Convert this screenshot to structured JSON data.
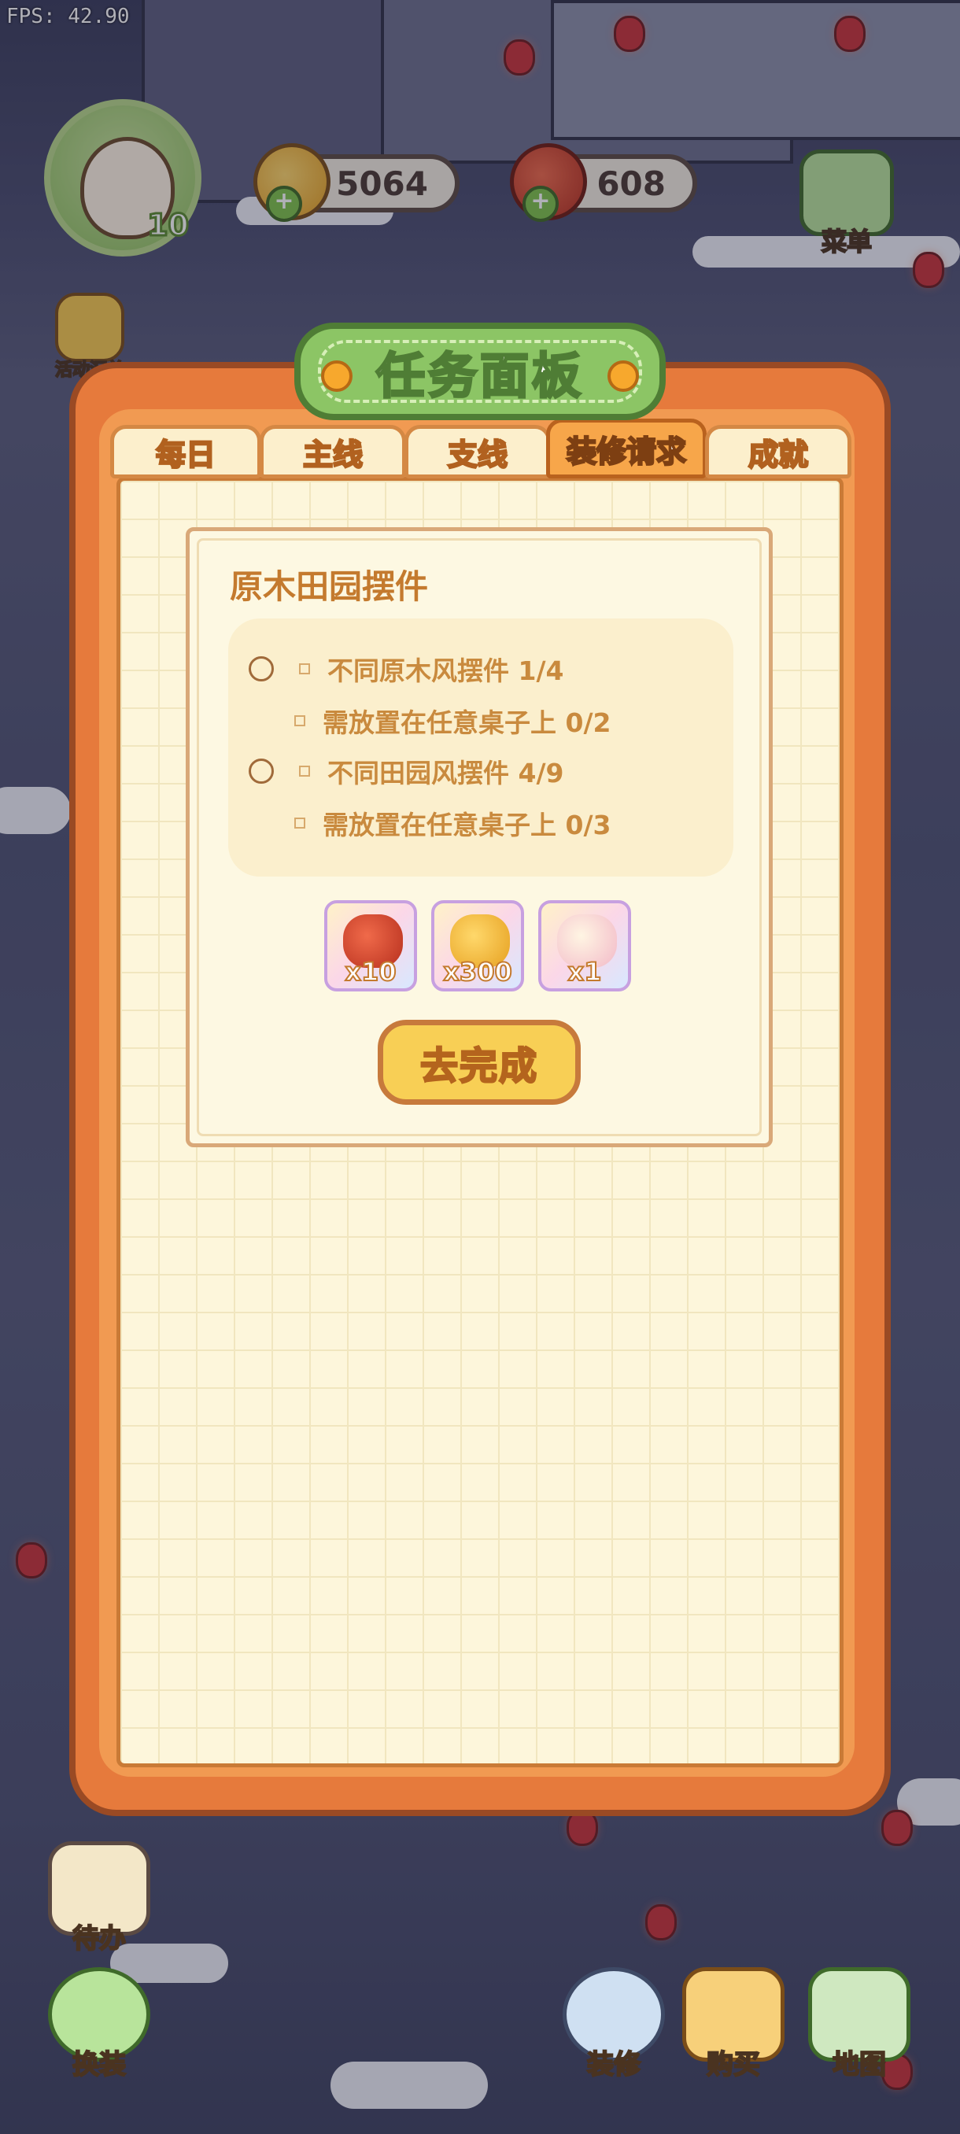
{
  "fps": "FPS: 42.90",
  "player": {
    "level": "10"
  },
  "resources": {
    "coins": "5064",
    "tomatoes": "608"
  },
  "left_menu": {
    "events": "活动汇总",
    "todo": "待办",
    "dress": "换装"
  },
  "right_menu": {
    "menu": "菜单"
  },
  "bottom_menu": {
    "decorate": "装修",
    "buy": "购买",
    "map": "地图"
  },
  "panel": {
    "title": "任务面板",
    "tabs": [
      {
        "label": "每日"
      },
      {
        "label": "主线"
      },
      {
        "label": "支线"
      },
      {
        "label": "装修请求"
      },
      {
        "label": "成就"
      }
    ],
    "active_tab": "装修请求",
    "task": {
      "title": "原木田园摆件",
      "requirements": [
        {
          "text": "不同原木风摆件 1/4"
        },
        {
          "text": "需放置在任意桌子上 0/2"
        },
        {
          "text": "不同田园风摆件 4/9"
        },
        {
          "text": "需放置在任意桌子上 0/3"
        }
      ],
      "rewards": [
        {
          "icon": "tomato-icon",
          "qty": "x10"
        },
        {
          "icon": "coin-pile-icon",
          "qty": "x300"
        },
        {
          "icon": "character-card-icon",
          "qty": "x1"
        }
      ],
      "go_button": "去完成"
    }
  },
  "colors": {
    "panel_orange": "#e67a3c",
    "title_green": "#8cc565",
    "paper": "#fdf6db",
    "button_yellow": "#f8cf55"
  }
}
